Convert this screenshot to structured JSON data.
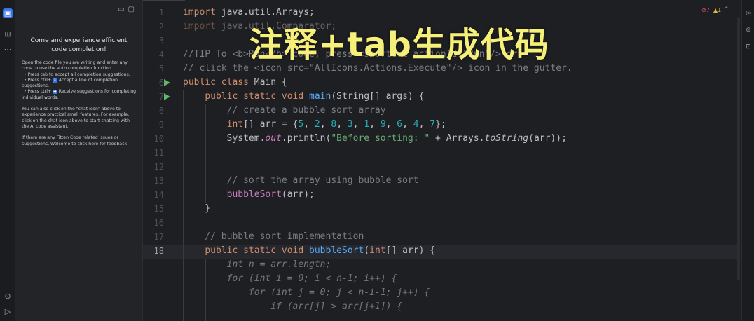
{
  "overlay_caption": "注释+tab生成代码",
  "left_strip": {
    "icons": [
      "fitten-code-icon",
      "structure-icon",
      "more-icon"
    ],
    "bottom_icons": [
      "services-icon",
      "run-icon"
    ]
  },
  "panel": {
    "title": "Come and experience efficient code completion!",
    "intro": "Open the code file you are writing and enter any code to use the auto completion function.",
    "bullet1_pre": "• Press tab to accept all completion suggestions.",
    "bullet2_pre": "• Press ctrl+",
    "bullet2_post": "Accept a line of completion suggestions.",
    "bullet3_pre": "• Press ctrl+",
    "bullet3_post": "Receive suggestions for completing individual words.",
    "chat_text": "You can also click on the \"chat icon\" above to experience practical small features. For example, click on the chat icon above to start chatting with the AI code assistant.",
    "feedback_text": "If there are any Fitten Code related issues or suggestions, Welcome to click here for feedback"
  },
  "editor": {
    "current_line": 18,
    "line_numbers": [
      "1",
      "2",
      "3",
      "4",
      "5",
      "6",
      "7",
      "8",
      "9",
      "10",
      "11",
      "12",
      "13",
      "14",
      "15",
      "16",
      "17",
      "18"
    ],
    "errors": "7",
    "warnings": "1"
  }
}
